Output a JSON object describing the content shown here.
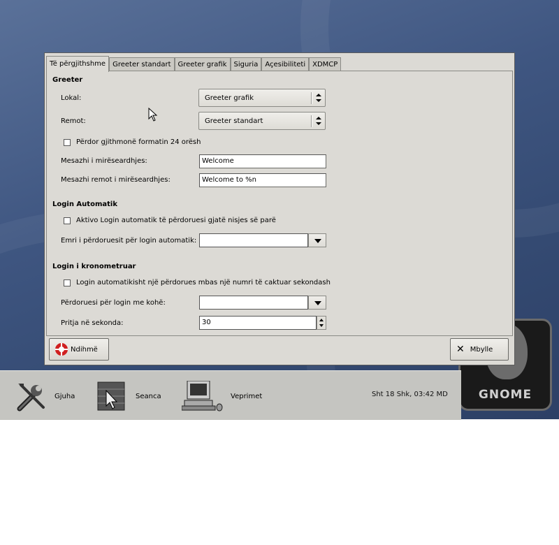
{
  "dialog": {
    "tabs": [
      {
        "label": "Të përgjithshme",
        "active": true
      },
      {
        "label": "Greeter standart",
        "active": false
      },
      {
        "label": "Greeter grafik",
        "active": false
      },
      {
        "label": "Siguria",
        "active": false
      },
      {
        "label": "Açesibiliteti",
        "active": false
      },
      {
        "label": "XDMCP",
        "active": false
      }
    ],
    "greeter": {
      "title": "Greeter",
      "local_label": "Lokal:",
      "local_value": "Greeter grafik",
      "remote_label": "Remot:",
      "remote_value": "Greeter standart",
      "use24_label": "Përdor gjithmonë formatin 24 orësh",
      "use24_checked": false,
      "welcome_label": "Mesazhi i mirëseardhjes:",
      "welcome_value": "Welcome",
      "remote_welcome_label": "Mesazhi remot i mirëseardhjes:",
      "remote_welcome_value": "Welcome to %n"
    },
    "autologin": {
      "title": "Login Automatik",
      "enable_label": "Aktivo Login automatik të përdoruesi gjatë nisjes së parë",
      "enable_checked": false,
      "user_label": "Emri i përdoruesit për login automatik:",
      "user_value": ""
    },
    "timedlogin": {
      "title": "Login i kronometruar",
      "enable_label": "Login automatikisht një përdorues mbas një numri të caktuar sekondash",
      "enable_checked": false,
      "user_label": "Përdoruesi për login me kohë:",
      "user_value": "",
      "pause_label": "Pritja në sekonda:",
      "pause_value": "30"
    },
    "buttons": {
      "help": "Ndihmë",
      "close": "Mbylle"
    }
  },
  "panel": {
    "items": [
      {
        "label": "Gjuha",
        "icon": "tools-icon"
      },
      {
        "label": "Seanca",
        "icon": "session-icon"
      },
      {
        "label": "Veprimet",
        "icon": "computer-icon"
      }
    ],
    "clock": "Sht  18 Shk, 03:42 MD"
  },
  "logo": {
    "text": "GNOME"
  }
}
